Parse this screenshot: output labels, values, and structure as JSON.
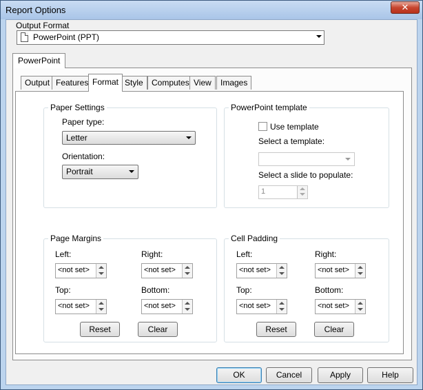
{
  "window": {
    "title": "Report Options",
    "close_glyph": "✕"
  },
  "output_format": {
    "label": "Output Format",
    "value": "PowerPoint (PPT)",
    "icon": "document-icon"
  },
  "outer_tab": {
    "label": "PowerPoint"
  },
  "inner_tabs": [
    {
      "label": "Output"
    },
    {
      "label": "Features"
    },
    {
      "label": "Format",
      "active": true
    },
    {
      "label": "Style"
    },
    {
      "label": "Computes"
    },
    {
      "label": "View"
    },
    {
      "label": "Images"
    }
  ],
  "paper_settings": {
    "title": "Paper Settings",
    "paper_type_label": "Paper type:",
    "paper_type_value": "Letter",
    "orientation_label": "Orientation:",
    "orientation_value": "Portrait"
  },
  "ppt_template": {
    "title": "PowerPoint template",
    "use_template_label": "Use template",
    "use_template_checked": false,
    "select_template_label": "Select a template:",
    "select_template_value": "",
    "select_slide_label": "Select a slide to populate:",
    "select_slide_value": "1"
  },
  "page_margins": {
    "title": "Page Margins",
    "left_label": "Left:",
    "left_value": "<not set>",
    "right_label": "Right:",
    "right_value": "<not set>",
    "top_label": "Top:",
    "top_value": "<not set>",
    "bottom_label": "Bottom:",
    "bottom_value": "<not set>",
    "reset_label": "Reset",
    "clear_label": "Clear"
  },
  "cell_padding": {
    "title": "Cell Padding",
    "left_label": "Left:",
    "left_value": "<not set>",
    "right_label": "Right:",
    "right_value": "<not set>",
    "top_label": "Top:",
    "top_value": "<not set>",
    "bottom_label": "Bottom:",
    "bottom_value": "<not set>",
    "reset_label": "Reset",
    "clear_label": "Clear"
  },
  "footer": {
    "ok_label": "OK",
    "cancel_label": "Cancel",
    "apply_label": "Apply",
    "help_label": "Help"
  },
  "colors": {
    "window_frame": "#bcd4ee",
    "close_button": "#c7452f",
    "default_button_border": "#3c7fb1"
  }
}
